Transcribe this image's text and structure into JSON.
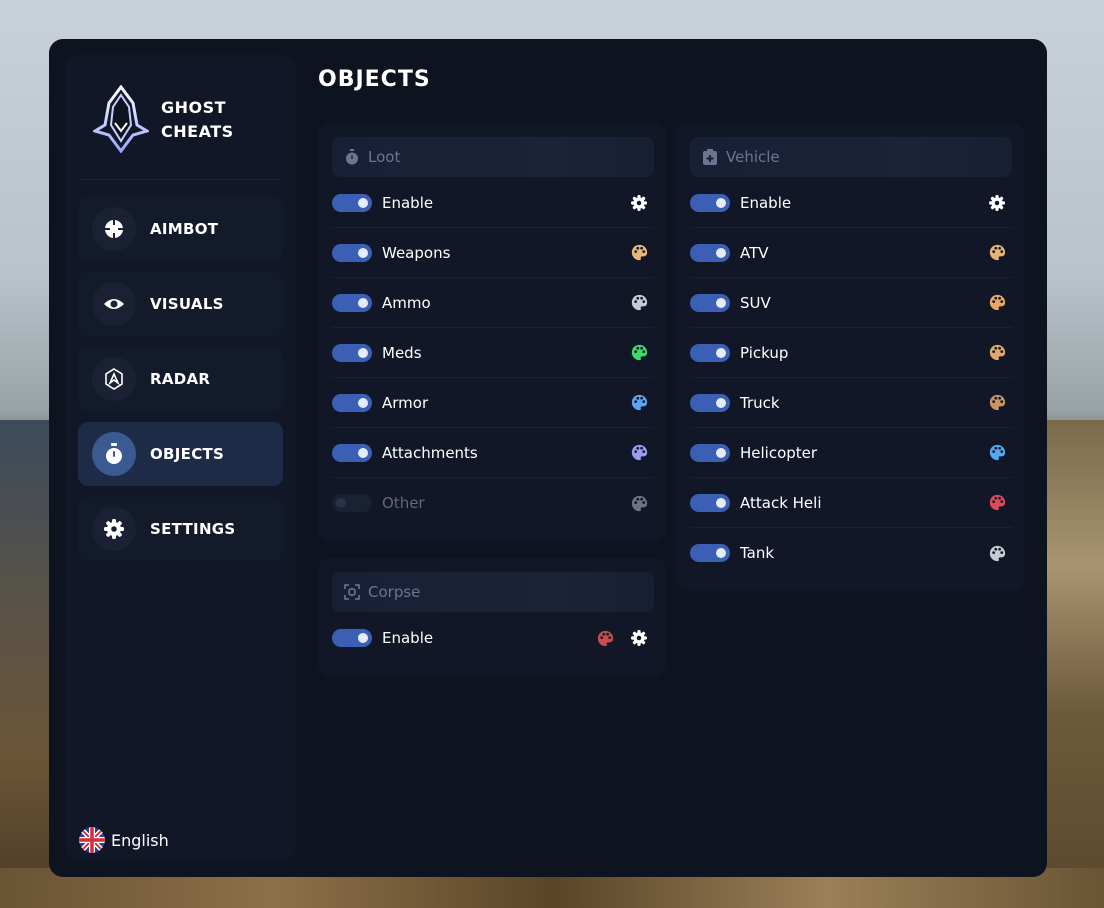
{
  "app": {
    "brand_line1": "GHOST",
    "brand_line2": "CHEATS"
  },
  "page": {
    "title": "OBJECTS"
  },
  "nav": [
    {
      "label": "AIMBOT",
      "icon": "crosshair-icon",
      "active": false
    },
    {
      "label": "VISUALS",
      "icon": "eye-icon",
      "active": false
    },
    {
      "label": "RADAR",
      "icon": "radar-icon",
      "active": false
    },
    {
      "label": "OBJECTS",
      "icon": "timer-icon",
      "active": true
    },
    {
      "label": "SETTINGS",
      "icon": "gear-icon",
      "active": false
    }
  ],
  "language": {
    "label": "English",
    "icon": "uk-flag-icon"
  },
  "loot": {
    "title": "Loot",
    "icon": "timer-icon",
    "rows": [
      {
        "label": "Enable",
        "enabled": true,
        "icon": "gear-icon"
      },
      {
        "label": "Weapons",
        "enabled": true,
        "icon": "palette-icon",
        "color": "#e8b878"
      },
      {
        "label": "Ammo",
        "enabled": true,
        "icon": "palette-icon",
        "color": "#c8ccd2"
      },
      {
        "label": "Meds",
        "enabled": true,
        "icon": "palette-icon",
        "color": "#3ddc6a"
      },
      {
        "label": "Armor",
        "enabled": true,
        "icon": "palette-icon",
        "color": "#5ba6f0"
      },
      {
        "label": "Attachments",
        "enabled": true,
        "icon": "palette-icon",
        "color": "#9b9cf0"
      },
      {
        "label": "Other",
        "enabled": false,
        "icon": "palette-icon",
        "color": "#6d7384"
      }
    ]
  },
  "corpse": {
    "title": "Corpse",
    "icon": "scan-icon",
    "rows": [
      {
        "label": "Enable",
        "enabled": true,
        "icons": [
          "palette-icon",
          "gear-icon"
        ],
        "color": "#c84c4c"
      }
    ]
  },
  "vehicle": {
    "title": "Vehicle",
    "icon": "medkit-icon",
    "rows": [
      {
        "label": "Enable",
        "enabled": true,
        "icon": "gear-icon"
      },
      {
        "label": "ATV",
        "enabled": true,
        "icon": "palette-icon",
        "color": "#e8b270"
      },
      {
        "label": "SUV",
        "enabled": true,
        "icon": "palette-icon",
        "color": "#e8a860"
      },
      {
        "label": "Pickup",
        "enabled": true,
        "icon": "palette-icon",
        "color": "#e0a868"
      },
      {
        "label": "Truck",
        "enabled": true,
        "icon": "palette-icon",
        "color": "#c89460"
      },
      {
        "label": "Helicopter",
        "enabled": true,
        "icon": "palette-icon",
        "color": "#4fa8f0"
      },
      {
        "label": "Attack Heli",
        "enabled": true,
        "icon": "palette-icon",
        "color": "#e04858"
      },
      {
        "label": "Tank",
        "enabled": true,
        "icon": "palette-icon",
        "color": "#c8ccd2"
      }
    ]
  }
}
